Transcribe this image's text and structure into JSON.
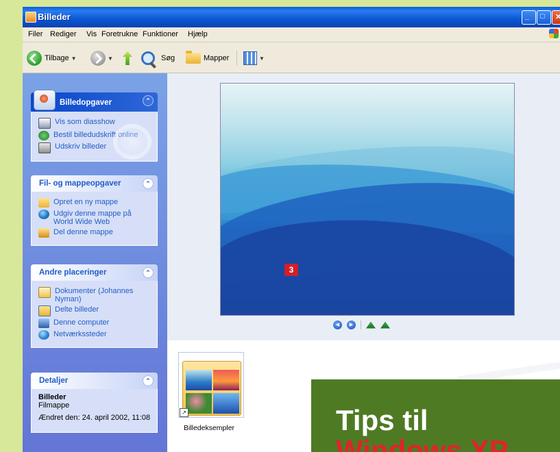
{
  "window": {
    "title": "Billeder"
  },
  "menu": [
    "Filer",
    "Rediger",
    "Vis",
    "Foretrukne",
    "Funktioner",
    "Hjælp"
  ],
  "toolbar": {
    "back": "Tilbage",
    "search": "Søg",
    "folders": "Mapper"
  },
  "panels": {
    "picture_tasks": {
      "title": "Billedopgaver",
      "items": [
        "Vis som diasshow",
        "Bestil billedudskrift online",
        "Udskriv billeder"
      ]
    },
    "file_tasks": {
      "title": "Fil- og mappeopgaver",
      "items": [
        "Opret en ny mappe",
        "Udgiv denne mappe på World Wide Web",
        "Del denne mappe"
      ]
    },
    "other_places": {
      "title": "Andre placeringer",
      "items": [
        "Dokumenter (Johannes Nyman)",
        "Delte billeder",
        "Denne computer",
        "Netværkssteder"
      ]
    },
    "details": {
      "title": "Detaljer",
      "name": "Billeder",
      "type": "Filmappe",
      "modified": "Ændret den: 24. april 2002, 11:08"
    }
  },
  "preview": {
    "badge": "3"
  },
  "folder": {
    "label": "Billedeksempler"
  },
  "overlay": {
    "line1": "Tips til",
    "line2_partial": "Windows XP"
  }
}
